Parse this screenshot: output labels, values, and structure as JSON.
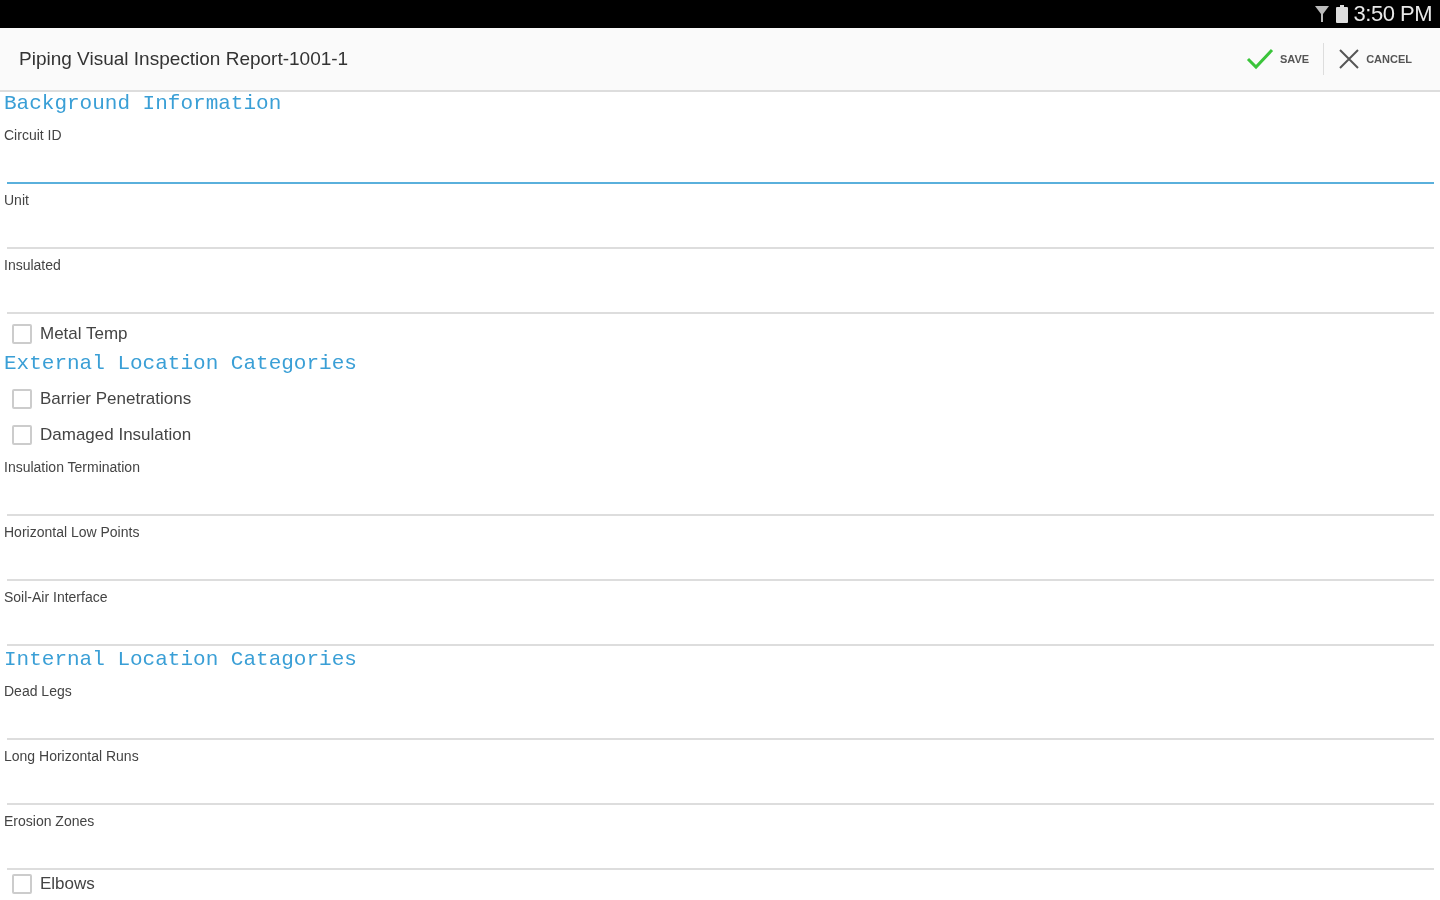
{
  "status_bar": {
    "time": "3:50 PM"
  },
  "toolbar": {
    "title": "Piping Visual Inspection Report-1001-1",
    "actions": [
      {
        "kind": "save",
        "label": "SAVE"
      },
      {
        "kind": "cancel",
        "label": "CANCEL"
      }
    ]
  },
  "form": [
    {
      "kind": "heading",
      "text": "Background Information"
    },
    {
      "kind": "field",
      "label": "Circuit ID",
      "focused": true
    },
    {
      "kind": "field",
      "label": "Unit",
      "focused": false
    },
    {
      "kind": "field",
      "label": "Insulated",
      "focused": false
    },
    {
      "kind": "checkbox",
      "label": "Metal Temp",
      "checked": false
    },
    {
      "kind": "heading",
      "text": "External Location Categories"
    },
    {
      "kind": "checkbox",
      "label": "Barrier Penetrations",
      "checked": false
    },
    {
      "kind": "checkbox",
      "label": "Damaged Insulation",
      "checked": false
    },
    {
      "kind": "field",
      "label": "Insulation Termination",
      "focused": false
    },
    {
      "kind": "field",
      "label": "Horizontal Low Points",
      "focused": false
    },
    {
      "kind": "field",
      "label": "Soil-Air Interface",
      "focused": false
    },
    {
      "kind": "heading",
      "text": "Internal Location Catagories"
    },
    {
      "kind": "field",
      "label": "Dead Legs",
      "focused": false
    },
    {
      "kind": "field",
      "label": "Long Horizontal Runs",
      "focused": false
    },
    {
      "kind": "field",
      "label": "Erosion Zones",
      "focused": false
    },
    {
      "kind": "checkbox",
      "label": "Elbows",
      "checked": false
    }
  ]
}
